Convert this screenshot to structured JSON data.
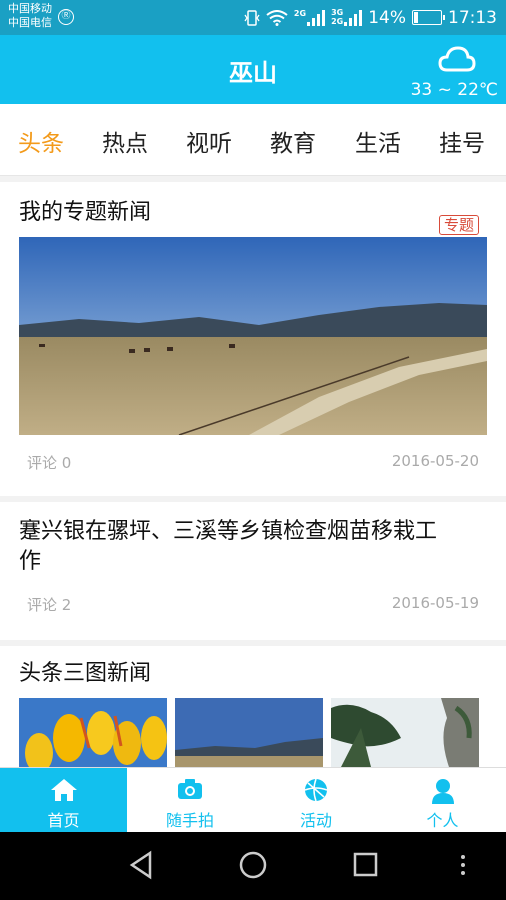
{
  "status_bar": {
    "carrier_1": "中国移动",
    "carrier_2": "中国电信",
    "net_1": "2G",
    "net_2a": "3G",
    "net_2b": "2G",
    "battery": "14%",
    "time": "17:13"
  },
  "header": {
    "title": "巫山",
    "weather_icon": "cloud-icon",
    "temperature": "33 ~ 22℃"
  },
  "tabs": [
    {
      "label": "头条",
      "active": true
    },
    {
      "label": "热点",
      "active": false
    },
    {
      "label": "视听",
      "active": false
    },
    {
      "label": "教育",
      "active": false
    },
    {
      "label": "生活",
      "active": false
    },
    {
      "label": "挂号",
      "active": false
    }
  ],
  "feed": {
    "card1": {
      "title": "我的专题新闻",
      "badge": "专题",
      "comments": "评论 0",
      "date": "2016-05-20"
    },
    "card2": {
      "title_line1": "蹇兴银在骡坪、三溪等乡镇检查烟苗移栽工",
      "title_line2": "作",
      "comments": "评论 2",
      "date": "2016-05-19"
    },
    "card3": {
      "title": "头条三图新闻"
    }
  },
  "bottom_nav": [
    {
      "label": "首页",
      "icon": "home-icon",
      "active": true
    },
    {
      "label": "随手拍",
      "icon": "camera-icon",
      "active": false
    },
    {
      "label": "活动",
      "icon": "ball-icon",
      "active": false
    },
    {
      "label": "个人",
      "icon": "person-icon",
      "active": false
    }
  ],
  "colors": {
    "accent": "#12c0ee",
    "active_tab": "#f39a1a",
    "badge": "#d84b3a"
  }
}
